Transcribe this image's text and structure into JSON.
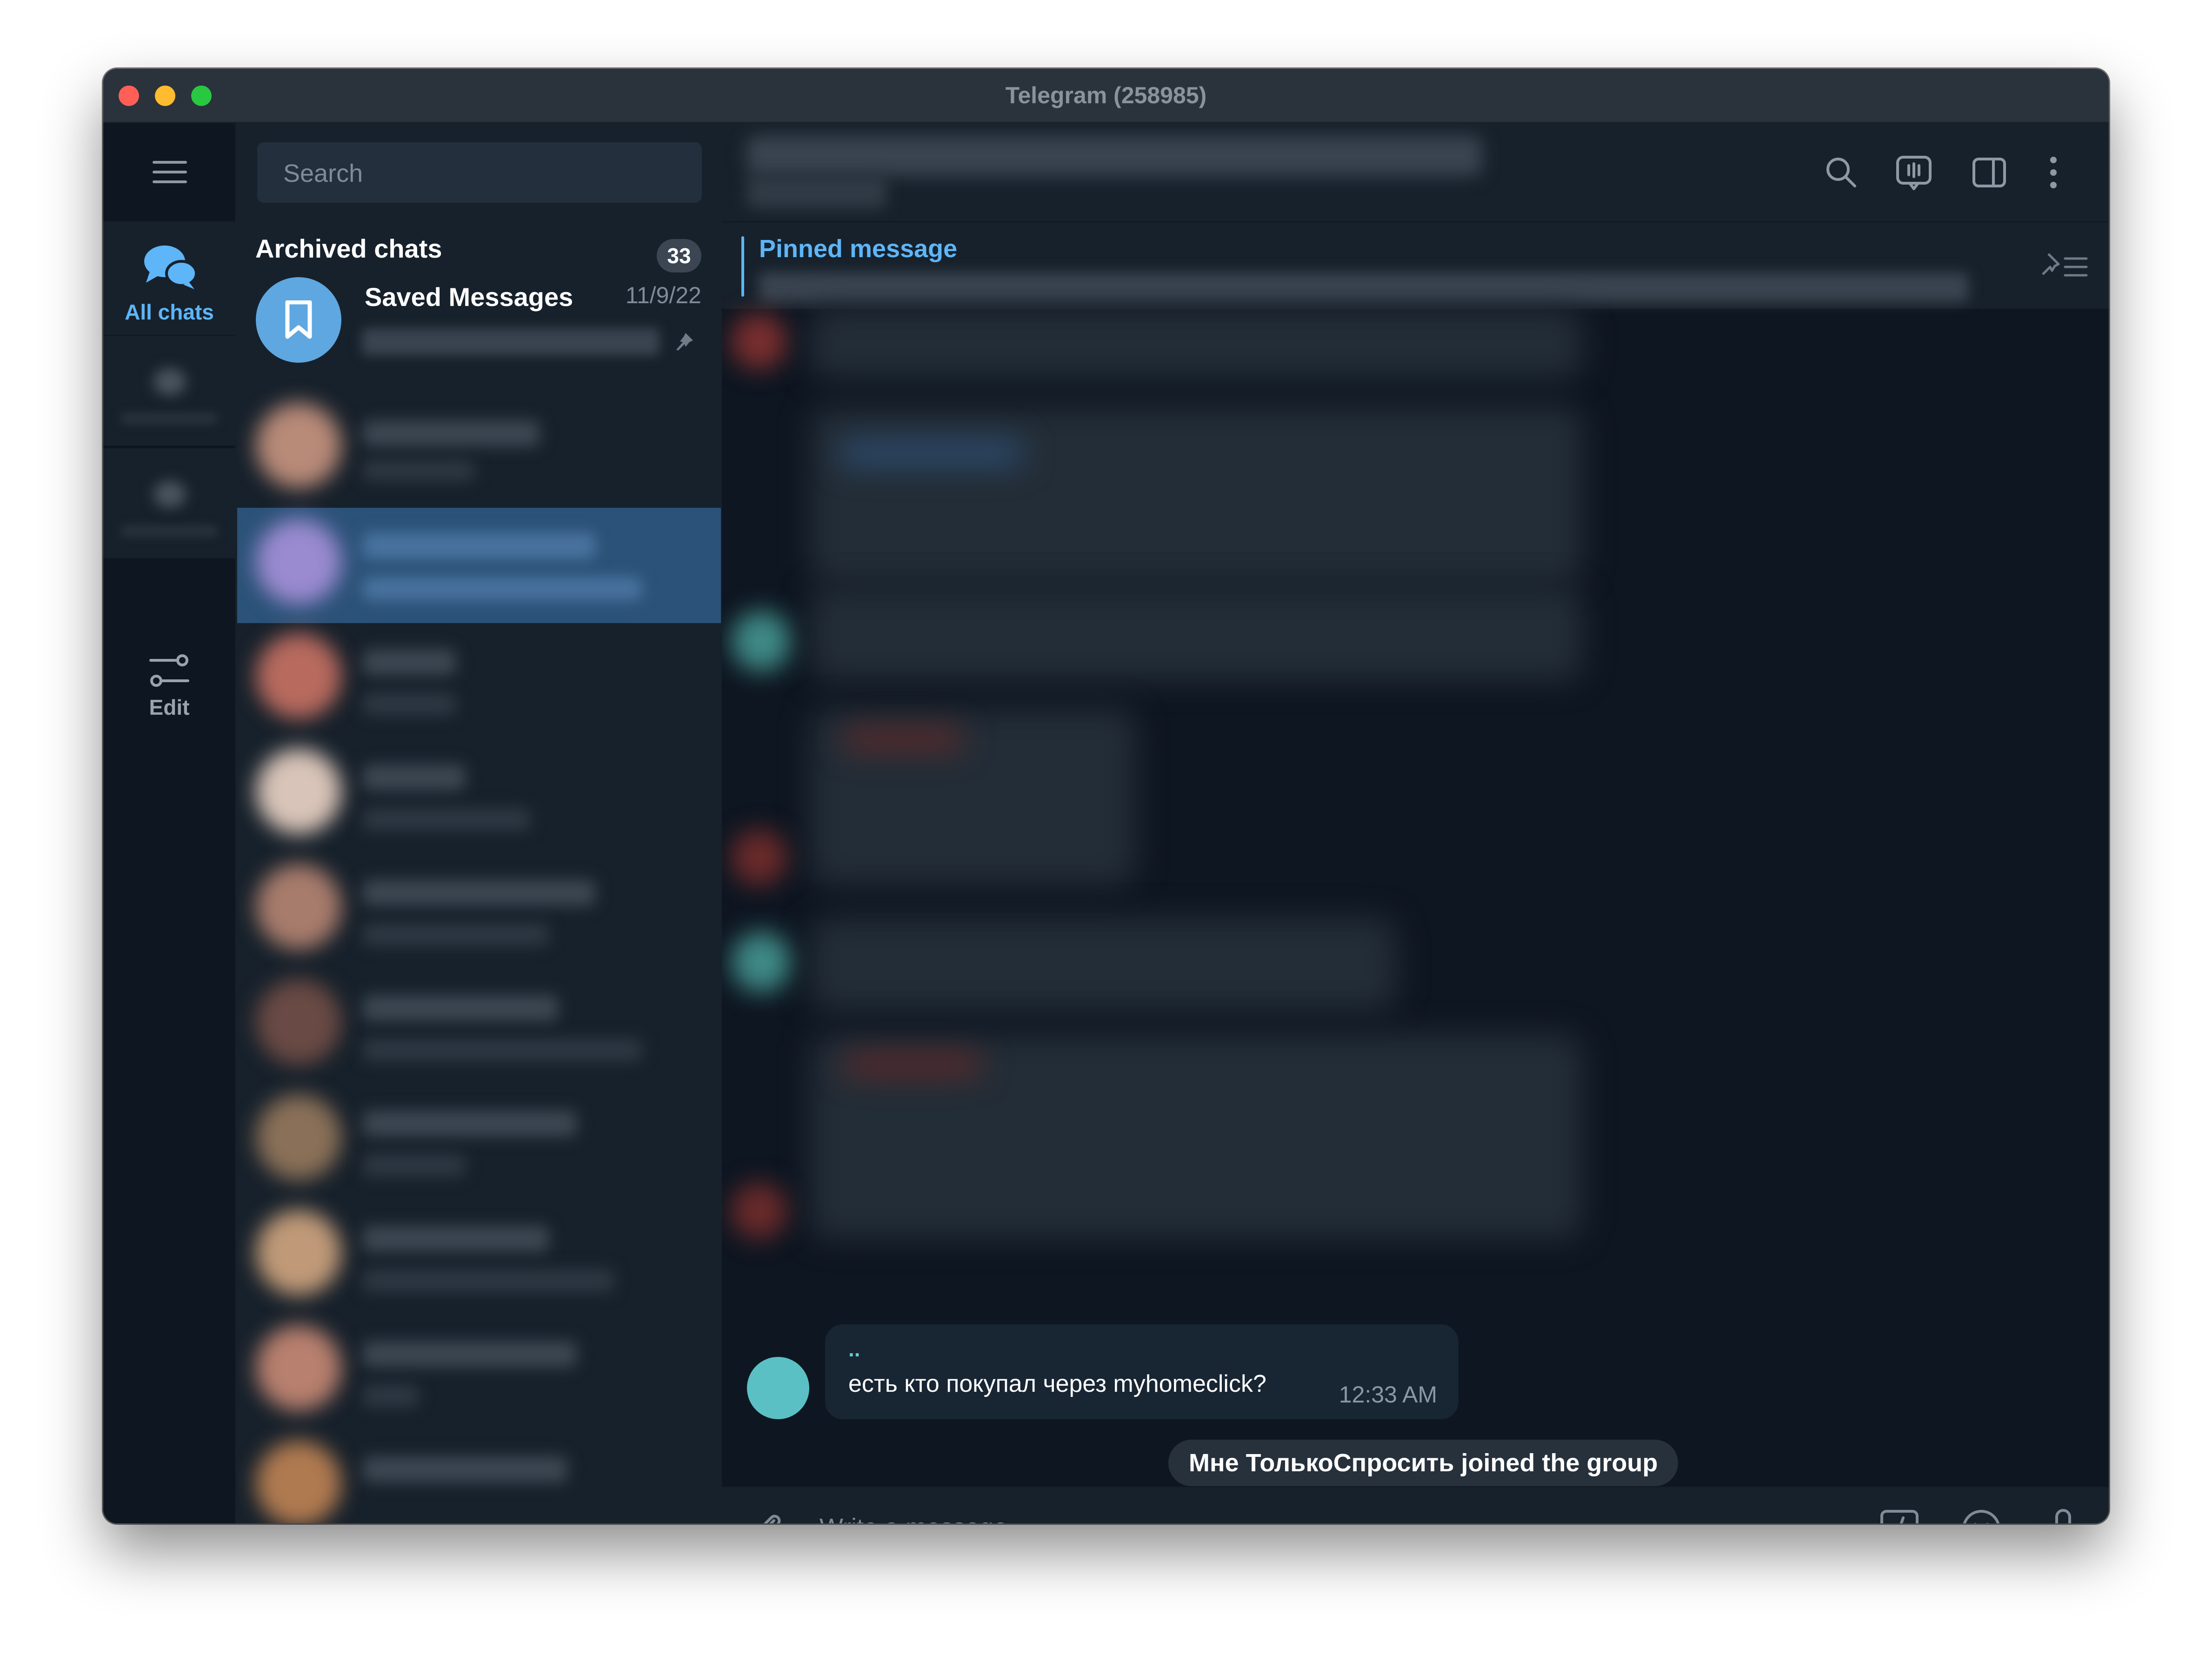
{
  "window": {
    "title": "Telegram (258985)"
  },
  "rail": {
    "all_chats_label": "All chats",
    "edit_label": "Edit"
  },
  "chat_list": {
    "search_placeholder": "Search",
    "archived_label": "Archived chats",
    "archived_count": "33",
    "saved": {
      "title": "Saved Messages",
      "time": "11/9/22"
    }
  },
  "conversation": {
    "pinned_label": "Pinned message",
    "last_message": {
      "sender": "..",
      "text": "есть кто покупал через myhomeclick?",
      "time": "12:33 AM"
    },
    "service_message": "Мне ТолькоСпросить joined the group",
    "composer_placeholder": "Write a message..."
  },
  "colors": {
    "accent": "#5eb5f7",
    "selected_row": "#2b5278",
    "bg_dark": "#0e1621",
    "panel": "#17212b",
    "avatar_teal": "#5bc0c4"
  },
  "icons": [
    "menu-icon",
    "chats-icon",
    "folder-icon",
    "edit-folders-icon",
    "bookmark-icon",
    "pin-icon",
    "search-icon",
    "live-stream-icon",
    "sidebar-toggle-icon",
    "more-icon",
    "pinned-list-icon",
    "attach-icon",
    "commands-icon",
    "emoji-icon",
    "microphone-icon"
  ]
}
